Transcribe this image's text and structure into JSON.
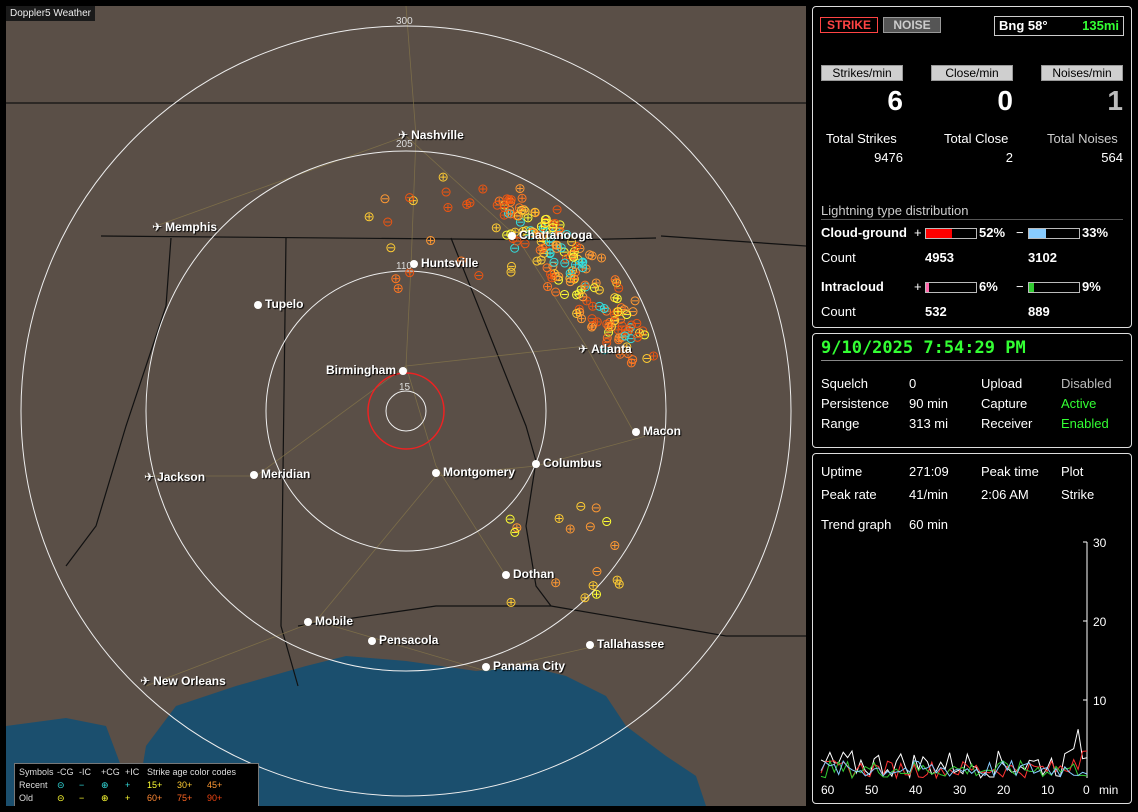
{
  "app_title": "Doppler5 Weather",
  "map": {
    "ring_labels": [
      "300",
      "205",
      "110",
      "15"
    ],
    "cities": [
      {
        "name": "Nashville",
        "icon": "plane-icon"
      },
      {
        "name": "Memphis",
        "icon": "plane-icon"
      },
      {
        "name": "Chattanooga",
        "icon": "dot-icon"
      },
      {
        "name": "Huntsville",
        "icon": "dot-icon"
      },
      {
        "name": "Tupelo",
        "icon": "dot-icon"
      },
      {
        "name": "Atlanta",
        "icon": "plane-icon"
      },
      {
        "name": "Birmingham",
        "icon": "dot-icon"
      },
      {
        "name": "Macon",
        "icon": "dot-icon"
      },
      {
        "name": "Jackson",
        "icon": "plane-icon"
      },
      {
        "name": "Meridian",
        "icon": "dot-icon"
      },
      {
        "name": "Montgomery",
        "icon": "dot-icon"
      },
      {
        "name": "Columbus",
        "icon": "dot-icon"
      },
      {
        "name": "Dothan",
        "icon": "dot-icon"
      },
      {
        "name": "Mobile",
        "icon": "dot-icon"
      },
      {
        "name": "Pensacola",
        "icon": "dot-icon"
      },
      {
        "name": "Tallahassee",
        "icon": "dot-icon"
      },
      {
        "name": "Panama City",
        "icon": "dot-icon"
      },
      {
        "name": "New Orleans",
        "icon": "plane-icon"
      }
    ],
    "legend": {
      "header": [
        "Symbols",
        "-CG",
        "-IC",
        "+CG",
        "+IC",
        "Strike age color codes"
      ],
      "recent": {
        "label": "Recent",
        "ages": [
          "15+",
          "30+",
          "45+"
        ]
      },
      "old": {
        "label": "Old",
        "ages": [
          "60+",
          "75+",
          "90+"
        ]
      }
    }
  },
  "panel1": {
    "strike_btn": "STRIKE",
    "noise_btn": "NOISE",
    "bearing": "Bng 58°",
    "distance": "135mi",
    "strikes_min_label": "Strikes/min",
    "close_min_label": "Close/min",
    "noises_min_label": "Noises/min",
    "strikes_min": "6",
    "close_min": "0",
    "noises_min": "1",
    "total_strikes_label": "Total Strikes",
    "total_close_label": "Total Close",
    "total_noises_label": "Total Noises",
    "total_strikes": "9476",
    "total_close": "2",
    "total_noises": "564",
    "dist_title": "Lightning type distribution",
    "cg_label": "Cloud-ground",
    "cg_pos_pct": "52%",
    "cg_neg_pct": "33%",
    "cg_pos_fill": 0.52,
    "cg_neg_fill": 0.33,
    "count_label": "Count",
    "cg_pos_count": "4953",
    "cg_neg_count": "3102",
    "ic_label": "Intracloud",
    "ic_pos_pct": "6%",
    "ic_neg_pct": "9%",
    "ic_pos_fill": 0.06,
    "ic_neg_fill": 0.09,
    "ic_pos_count": "532",
    "ic_neg_count": "889",
    "plus": "+",
    "minus": "−"
  },
  "panel2": {
    "datetime": "9/10/2025 7:54:29 PM",
    "squelch_label": "Squelch",
    "squelch": "0",
    "persistence_label": "Persistence",
    "persistence": "90 min",
    "range_label": "Range",
    "range": "313 mi",
    "upload_label": "Upload",
    "upload": "Disabled",
    "capture_label": "Capture",
    "capture": "Active",
    "receiver_label": "Receiver",
    "receiver": "Enabled"
  },
  "panel3": {
    "uptime_label": "Uptime",
    "uptime": "271:09",
    "peak_time_label": "Peak time",
    "peak_time": "2:06 AM",
    "plot_label": "Plot",
    "plot": "Strike",
    "peak_rate_label": "Peak rate",
    "peak_rate": "41/min",
    "trend_label": "Trend graph",
    "trend": "60 min",
    "y_ticks": [
      "30",
      "20",
      "10"
    ],
    "x_ticks": [
      "60",
      "50",
      "40",
      "30",
      "20",
      "10",
      "0"
    ],
    "x_unit": "min"
  },
  "colors": {
    "active": "#33ff33",
    "cg_pos": "#ff0000",
    "cg_neg": "#88ccff",
    "ic_pos": "#ff66aa",
    "ic_neg": "#33cc33",
    "map_land": "#5a4f47",
    "map_water": "#1b4f6e"
  }
}
